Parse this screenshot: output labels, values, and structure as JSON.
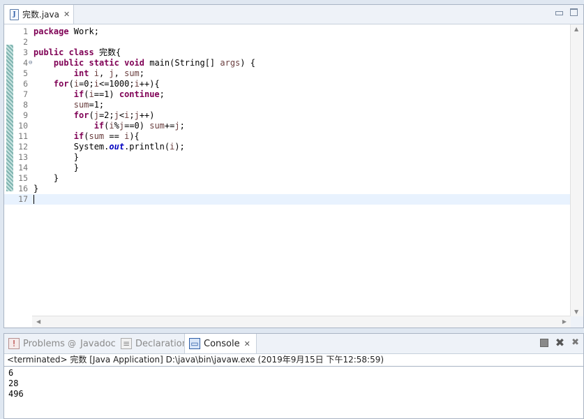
{
  "editor": {
    "tab_title": "完数.java",
    "tab_icon": "java-file-icon",
    "lines": [
      {
        "n": "1",
        "parts": [
          [
            "kw",
            "package"
          ],
          [
            "p",
            " Work;"
          ]
        ]
      },
      {
        "n": "2",
        "parts": []
      },
      {
        "n": "3",
        "parts": [
          [
            "kw",
            "public"
          ],
          [
            "p",
            " "
          ],
          [
            "kw",
            "class"
          ],
          [
            "p",
            " 完数{"
          ]
        ]
      },
      {
        "n": "4",
        "fold": "⊖",
        "parts": [
          [
            "p",
            "    "
          ],
          [
            "kw",
            "public"
          ],
          [
            "p",
            " "
          ],
          [
            "kw",
            "static"
          ],
          [
            "p",
            " "
          ],
          [
            "kw",
            "void"
          ],
          [
            "p",
            " main(String[] "
          ],
          [
            "v",
            "args"
          ],
          [
            "p",
            ") {"
          ]
        ]
      },
      {
        "n": "5",
        "parts": [
          [
            "p",
            "        "
          ],
          [
            "kw",
            "int"
          ],
          [
            "p",
            " "
          ],
          [
            "v",
            "i"
          ],
          [
            "p",
            ", "
          ],
          [
            "v",
            "j"
          ],
          [
            "p",
            ", "
          ],
          [
            "v",
            "sum"
          ],
          [
            "p",
            ";"
          ]
        ]
      },
      {
        "n": "6",
        "parts": [
          [
            "p",
            "    "
          ],
          [
            "kw",
            "for"
          ],
          [
            "p",
            "("
          ],
          [
            "v",
            "i"
          ],
          [
            "p",
            "=0;"
          ],
          [
            "v",
            "i"
          ],
          [
            "p",
            "<=1000;"
          ],
          [
            "v",
            "i"
          ],
          [
            "p",
            "++){"
          ]
        ]
      },
      {
        "n": "7",
        "parts": [
          [
            "p",
            "        "
          ],
          [
            "kw",
            "if"
          ],
          [
            "p",
            "("
          ],
          [
            "v",
            "i"
          ],
          [
            "p",
            "==1) "
          ],
          [
            "kw",
            "continue"
          ],
          [
            "p",
            ";"
          ]
        ]
      },
      {
        "n": "8",
        "parts": [
          [
            "p",
            "        "
          ],
          [
            "v",
            "sum"
          ],
          [
            "p",
            "=1;"
          ]
        ]
      },
      {
        "n": "9",
        "parts": [
          [
            "p",
            "        "
          ],
          [
            "kw",
            "for"
          ],
          [
            "p",
            "("
          ],
          [
            "v",
            "j"
          ],
          [
            "p",
            "=2;"
          ],
          [
            "v",
            "j"
          ],
          [
            "p",
            "<"
          ],
          [
            "v",
            "i"
          ],
          [
            "p",
            ";"
          ],
          [
            "v",
            "j"
          ],
          [
            "p",
            "++)"
          ]
        ]
      },
      {
        "n": "10",
        "parts": [
          [
            "p",
            "            "
          ],
          [
            "kw",
            "if"
          ],
          [
            "p",
            "("
          ],
          [
            "v",
            "i"
          ],
          [
            "p",
            "%"
          ],
          [
            "v",
            "j"
          ],
          [
            "p",
            "==0) "
          ],
          [
            "v",
            "sum"
          ],
          [
            "p",
            "+="
          ],
          [
            "v",
            "j"
          ],
          [
            "p",
            ";"
          ]
        ]
      },
      {
        "n": "11",
        "parts": [
          [
            "p",
            "        "
          ],
          [
            "kw",
            "if"
          ],
          [
            "p",
            "("
          ],
          [
            "v",
            "sum"
          ],
          [
            "p",
            " == "
          ],
          [
            "v",
            "i"
          ],
          [
            "p",
            "){"
          ]
        ]
      },
      {
        "n": "12",
        "parts": [
          [
            "p",
            "        System."
          ],
          [
            "f",
            "out"
          ],
          [
            "p",
            ".println("
          ],
          [
            "v",
            "i"
          ],
          [
            "p",
            ");"
          ]
        ]
      },
      {
        "n": "13",
        "parts": [
          [
            "p",
            "        }"
          ]
        ]
      },
      {
        "n": "14",
        "parts": [
          [
            "p",
            "        }"
          ]
        ]
      },
      {
        "n": "15",
        "parts": [
          [
            "p",
            "    }"
          ]
        ]
      },
      {
        "n": "16",
        "parts": [
          [
            "p",
            "}"
          ]
        ]
      },
      {
        "n": "17",
        "parts": [],
        "current": true
      }
    ]
  },
  "console": {
    "tabs": [
      {
        "label": "Problems",
        "icon": "problems-icon",
        "active": false
      },
      {
        "label": "Javadoc",
        "icon": "javadoc-icon",
        "active": false
      },
      {
        "label": "Declaration",
        "icon": "declaration-icon",
        "active": false
      },
      {
        "label": "Console",
        "icon": "console-icon",
        "active": true
      }
    ],
    "header": "<terminated> 完数 [Java Application] D:\\java\\bin\\javaw.exe (2019年9月15日 下午12:58:59)",
    "output": [
      "6",
      "28",
      "496"
    ]
  },
  "colors": {
    "keyword": "#7f0055",
    "variable": "#6a3e3e",
    "field": "#0000c0",
    "current_line": "#e8f2fe"
  }
}
